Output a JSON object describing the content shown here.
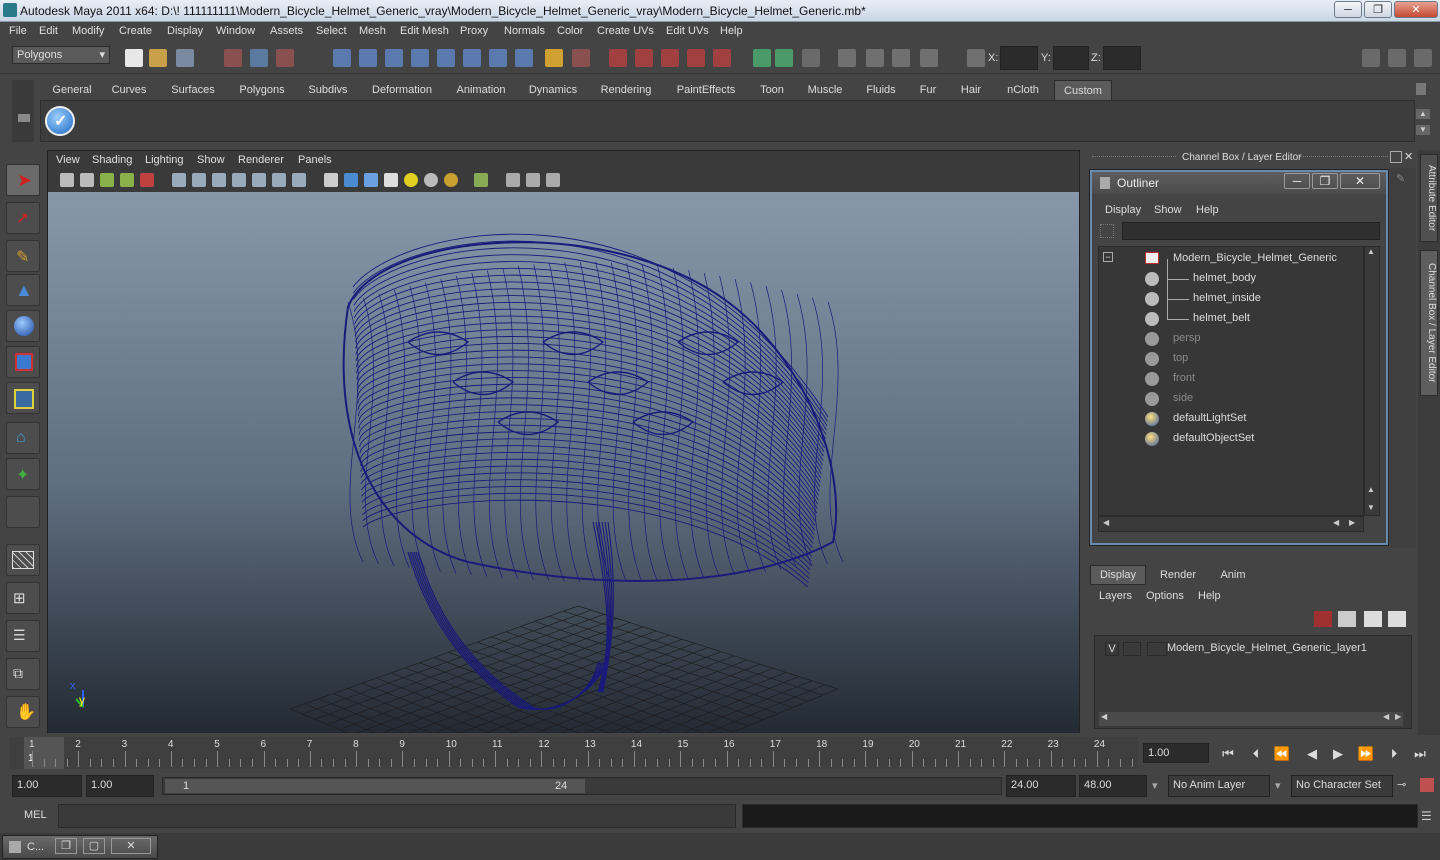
{
  "window": {
    "title": "Autodesk Maya 2011 x64: D:\\! 111111111\\Modern_Bicycle_Helmet_Generic_vray\\Modern_Bicycle_Helmet_Generic_vray\\Modern_Bicycle_Helmet_Generic.mb*",
    "minimize": "─",
    "maximize": "❐",
    "close": "✕"
  },
  "menubar": [
    "File",
    "Edit",
    "Modify",
    "Create",
    "Display",
    "Window",
    "Assets",
    "Select",
    "Mesh",
    "Edit Mesh",
    "Proxy",
    "Normals",
    "Color",
    "Create UVs",
    "Edit UVs",
    "Help"
  ],
  "statusline": {
    "mode": "Polygons",
    "x_label": "X:",
    "y_label": "Y:",
    "z_label": "Z:"
  },
  "shelf_tabs": [
    "General",
    "Curves",
    "Surfaces",
    "Polygons",
    "Subdivs",
    "Deformation",
    "Animation",
    "Dynamics",
    "Rendering",
    "PaintEffects",
    "Toon",
    "Muscle",
    "Fluids",
    "Fur",
    "Hair",
    "nCloth",
    "Custom"
  ],
  "active_shelf": "Custom",
  "viewport": {
    "menus": [
      "View",
      "Shading",
      "Lighting",
      "Show",
      "Renderer",
      "Panels"
    ],
    "axis_x": "x",
    "axis_y": "y",
    "wire_color": "#1a1a7a"
  },
  "channel_box": {
    "title": "Channel Box / Layer Editor"
  },
  "outliner": {
    "title": "Outliner",
    "menus": [
      "Display",
      "Show",
      "Help"
    ],
    "items": [
      {
        "name": "Modern_Bicycle_Helmet_Generic",
        "icon": "group-icon",
        "level": 0,
        "dim": false
      },
      {
        "name": "helmet_body",
        "icon": "mesh-icon",
        "level": 1,
        "dim": false
      },
      {
        "name": "helmet_inside",
        "icon": "mesh-icon",
        "level": 1,
        "dim": false
      },
      {
        "name": "helmet_belt",
        "icon": "mesh-icon",
        "level": 1,
        "dim": false
      },
      {
        "name": "persp",
        "icon": "camera-icon",
        "level": 0,
        "dim": true
      },
      {
        "name": "top",
        "icon": "camera-icon",
        "level": 0,
        "dim": true
      },
      {
        "name": "front",
        "icon": "camera-icon",
        "level": 0,
        "dim": true
      },
      {
        "name": "side",
        "icon": "camera-icon",
        "level": 0,
        "dim": true
      },
      {
        "name": "defaultLightSet",
        "icon": "set-icon",
        "level": 0,
        "dim": false
      },
      {
        "name": "defaultObjectSet",
        "icon": "set-icon",
        "level": 0,
        "dim": false
      }
    ]
  },
  "layer_editor": {
    "tabs": [
      "Display",
      "Render",
      "Anim"
    ],
    "menus": [
      "Layers",
      "Options",
      "Help"
    ],
    "layer": {
      "visible": "V",
      "name": "Modern_Bicycle_Helmet_Generic_layer1"
    }
  },
  "side_tabs": [
    "Attribute Editor",
    "Channel Box / Layer Editor"
  ],
  "timeline": {
    "ticks": [
      "1",
      "2",
      "3",
      "4",
      "5",
      "6",
      "7",
      "8",
      "9",
      "10",
      "11",
      "12",
      "13",
      "14",
      "15",
      "16",
      "17",
      "18",
      "19",
      "20",
      "21",
      "22",
      "23",
      "24"
    ],
    "current_frame_marker": "1",
    "current_time": "1.00"
  },
  "range": {
    "start": "1.00",
    "playback_start": "1.00",
    "slider_min": "1",
    "slider_max": "24",
    "playback_end": "24.00",
    "end": "48.00",
    "anim_layer": "No Anim Layer",
    "character_set": "No Character Set"
  },
  "command_line": {
    "label": "MEL",
    "value": ""
  },
  "bottom_window": {
    "label": "C..."
  }
}
